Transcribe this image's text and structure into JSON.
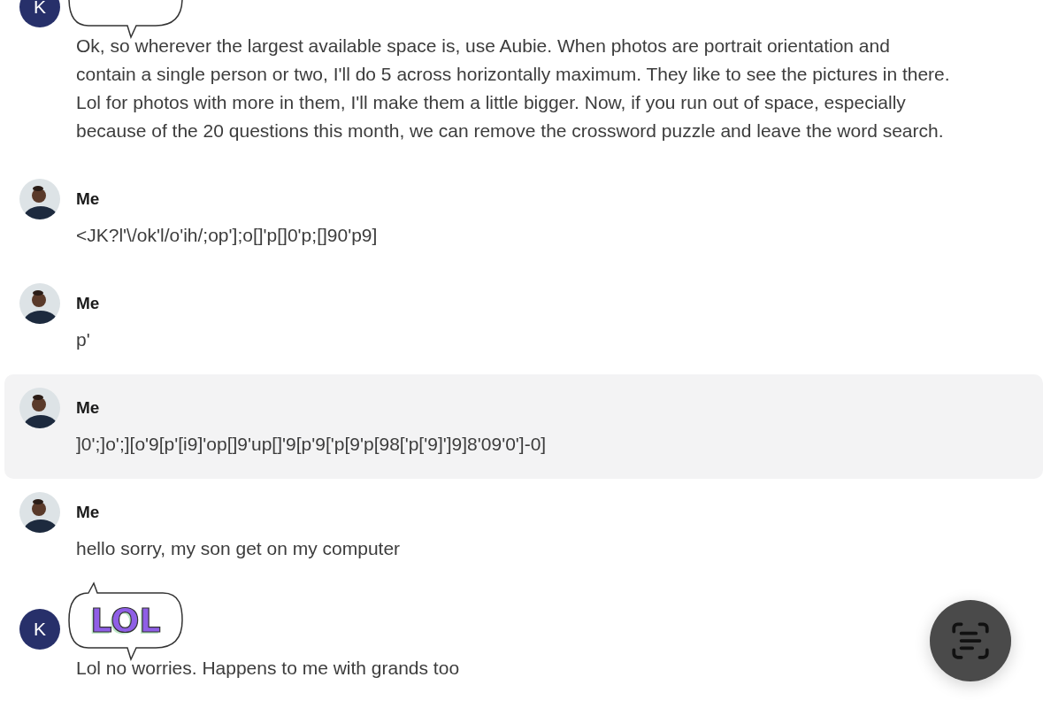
{
  "messages": [
    {
      "author": {
        "kind": "initial",
        "initial": "K"
      },
      "sticker": {
        "kind": "bubble"
      },
      "highlighted": false,
      "text": "Ok, so wherever the largest available space is,  use Aubie. When photos are portrait orientation and contain a single person or two, I'll do 5 across horizontally maximum. They like to see the pictures in there.  Lol for photos with more in them, I'll make them a little bigger. Now, if you run out of space, especially because of the 20 questions this month, we can remove the crossword puzzle and leave the word search."
    },
    {
      "author": {
        "kind": "photo",
        "name": "Me"
      },
      "highlighted": false,
      "text": "<JK?l'\\/ok'l/o'ih/;op'];o[]'p[]0'p;[]90'p9]"
    },
    {
      "author": {
        "kind": "photo",
        "name": "Me"
      },
      "highlighted": false,
      "text": "p'"
    },
    {
      "author": {
        "kind": "photo",
        "name": "Me"
      },
      "highlighted": true,
      "text": "]0';]o';][o'9[p'[i9]'op[]9'up[]'9[p'9['p[9'p[98['p['9]']9]8'09'0']-0]"
    },
    {
      "author": {
        "kind": "photo",
        "name": "Me"
      },
      "highlighted": false,
      "text": "hello sorry, my son get on my computer"
    },
    {
      "author": {
        "kind": "initial",
        "initial": "K"
      },
      "sticker": {
        "kind": "bubble",
        "label": "LOL"
      },
      "highlighted": false,
      "text": "Lol no worries. Happens to me with grands too"
    }
  ],
  "fab": {
    "kind": "scan-text"
  }
}
